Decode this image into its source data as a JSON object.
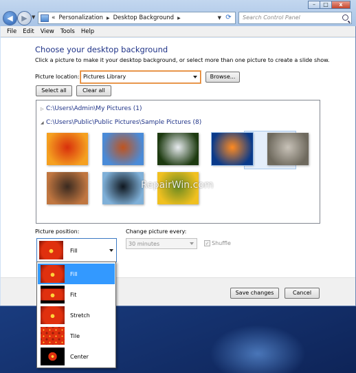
{
  "window": {
    "breadcrumb": [
      "«",
      "Personalization",
      "Desktop Background"
    ],
    "search_placeholder": "Search Control Panel",
    "controls": {
      "minimize": "–",
      "maximize": "□",
      "close": "x"
    }
  },
  "menu": [
    "File",
    "Edit",
    "View",
    "Tools",
    "Help"
  ],
  "main": {
    "heading": "Choose your desktop background",
    "instruction": "Click a picture to make it your desktop background, or select more than one picture to create a slide show.",
    "location_label": "Picture location:",
    "location_value": "Pictures Library",
    "browse_label": "Browse...",
    "select_all_label": "Select all",
    "clear_all_label": "Clear all"
  },
  "gallery": {
    "groups": [
      {
        "path": "C:\\Users\\Admin\\My Pictures (1)",
        "expanded": false
      },
      {
        "path": "C:\\Users\\Public\\Public Pictures\\Sample Pictures (8)",
        "expanded": true
      }
    ],
    "thumbnails": [
      {
        "name": "chrysanthemum",
        "colors": [
          "#f5a020",
          "#d8300c"
        ]
      },
      {
        "name": "desert",
        "colors": [
          "#4a8bd8",
          "#c0541e"
        ]
      },
      {
        "name": "hydrangeas",
        "colors": [
          "#1d3a10",
          "#e8ecf0"
        ]
      },
      {
        "name": "jellyfish",
        "colors": [
          "#0a3a8a",
          "#ff8a20"
        ],
        "selected": true
      },
      {
        "name": "koala",
        "colors": [
          "#6f6a5e",
          "#c8c2b8"
        ]
      },
      {
        "name": "lighthouse",
        "colors": [
          "#c07640",
          "#3a2a20"
        ]
      },
      {
        "name": "penguins",
        "colors": [
          "#7fb0d8",
          "#101820"
        ]
      },
      {
        "name": "tulips",
        "colors": [
          "#f0c020",
          "#6a8a20"
        ]
      }
    ],
    "watermark": "RepairWin.com"
  },
  "position": {
    "label": "Picture position:",
    "value": "Fill",
    "options": [
      "Fill",
      "Fit",
      "Stretch",
      "Tile",
      "Center"
    ]
  },
  "change": {
    "label": "Change picture every:",
    "value": "30 minutes",
    "shuffle_label": "Shuffle"
  },
  "footer": {
    "save_label": "Save changes",
    "cancel_label": "Cancel"
  },
  "colors": {
    "heading": "#1e3287",
    "highlight": "#3399ff"
  }
}
